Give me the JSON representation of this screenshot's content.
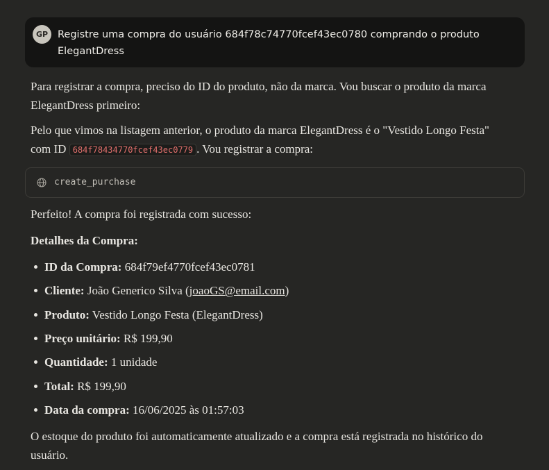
{
  "user_message": {
    "avatar_initials": "GP",
    "text": "Registre uma compra do usuário 684f78c74770fcef43ec0780 comprando o produto ElegantDress"
  },
  "assistant": {
    "para1": "Para registrar a compra, preciso do ID do produto, não da marca. Vou buscar o produto da marca ElegantDress primeiro:",
    "para2_before": "Pelo que vimos na listagem anterior, o produto da marca ElegantDress é o \"Vestido Longo Festa\" com ID ",
    "para2_code": "684f78434770fcef43ec0779",
    "para2_after": ". Vou registrar a compra:",
    "tool_call": {
      "icon": "globe-icon",
      "name": "create_purchase"
    },
    "para3": "Perfeito! A compra foi registrada com sucesso:",
    "details_heading": "Detalhes da Compra:",
    "details": {
      "purchase_id_label": "ID da Compra:",
      "purchase_id_value": " 684f79ef4770fcef43ec0781",
      "client_label": "Cliente:",
      "client_name": " João Generico Silva (",
      "client_email": "joaoGS@email.com",
      "client_close": ")",
      "product_label": "Produto:",
      "product_value": " Vestido Longo Festa (ElegantDress)",
      "unit_price_label": "Preço unitário:",
      "unit_price_value": " R$ 199,90",
      "quantity_label": "Quantidade:",
      "quantity_value": " 1 unidade",
      "total_label": "Total:",
      "total_value": " R$ 199,90",
      "date_label": "Data da compra:",
      "date_value": " 16/06/2025 às 01:57:03"
    },
    "para4": "O estoque do produto foi automaticamente atualizado e a compra está registrada no histórico do usuário."
  },
  "colors": {
    "background": "#262624",
    "user_bubble": "#141413",
    "code_text": "#e3706d",
    "text": "#e8e6e1"
  }
}
